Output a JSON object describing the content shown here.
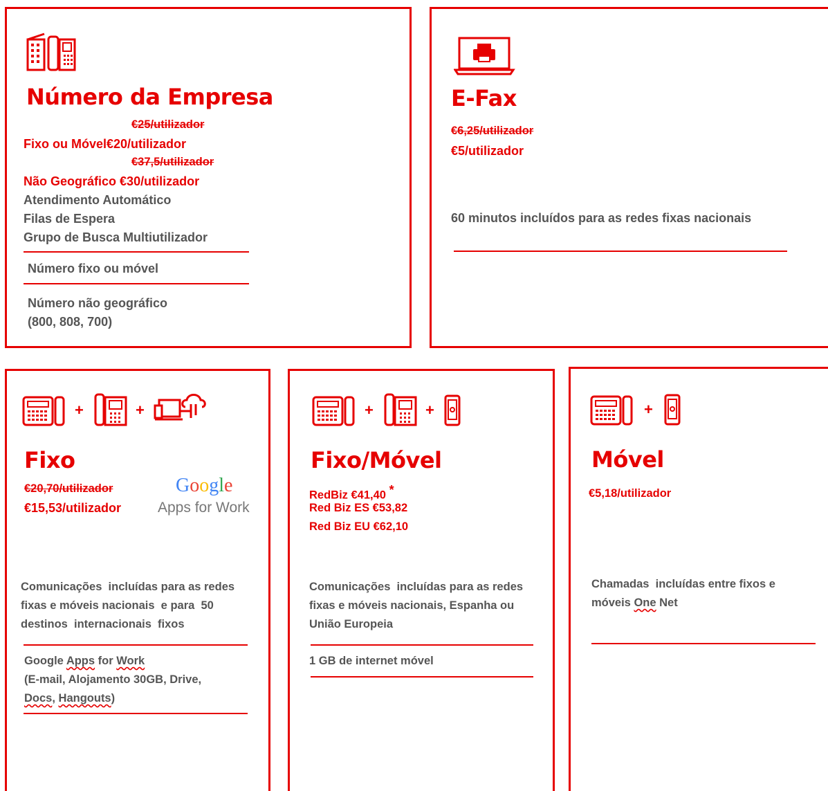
{
  "numero_empresa": {
    "icon": "office-phone-icon",
    "title": "Número da Empresa",
    "fixo_old_price": "€25/utilizador",
    "fixo_label": "Fixo ou Móvel",
    "fixo_price": "€20/utilizador",
    "ng_old_price": "€37,5/utilizador",
    "ng_label": "Não Geográfico",
    "ng_price": "€30/utilizador",
    "features": [
      "Atendimento Automático",
      "Filas de Espera",
      "Grupo de Busca Multiutilizador"
    ],
    "option_1": "Número fixo ou móvel",
    "option_2_line1": "Número não geográfico",
    "option_2_line2": "(800, 808, 700)"
  },
  "efax": {
    "icon": "laptop-fax-icon",
    "title": "E-Fax",
    "old_price": "€6,25/utilizador",
    "price": "€5/utilizador",
    "description": "60 minutos incluídos para as redes fixas nacionais"
  },
  "fixo": {
    "icons": [
      "desk-phone-icon",
      "office-phone-icon",
      "laptop-cloud-icon"
    ],
    "plus": "+",
    "title": "Fixo",
    "old_price": "€20,70/utilizador",
    "price": "€15,53/utilizador",
    "google_letters": [
      "G",
      "o",
      "o",
      "g",
      "l",
      "e"
    ],
    "google_sub": "Apps for Work",
    "description_lines": [
      "Comunicações  incluídas para as redes",
      "fixas e móveis nacionais  e para  50",
      "destinos  internacionais  fixos"
    ],
    "extra_line1_a": "Google ",
    "extra_line1_b": "Apps",
    "extra_line1_c": " for ",
    "extra_line1_d": "Work",
    "extra_line2": "(E-mail, Alojamento 30GB, Drive,",
    "extra_line3_a": "Docs",
    "extra_line3_b": ", ",
    "extra_line3_c": "Hangouts",
    "extra_line3_d": ")"
  },
  "fixo_movel": {
    "icons": [
      "desk-phone-icon",
      "office-phone-icon",
      "mobile-phone-icon"
    ],
    "plus": "+",
    "title": "Fixo/Móvel",
    "prices": [
      "RedBiz €41,40",
      "Red Biz ES €53,82",
      "Red Biz EU €62,10"
    ],
    "asterisk": "*",
    "description_lines": [
      "Comunicações  incluídas para as redes",
      "fixas e móveis nacionais, Espanha ou",
      "União Europeia"
    ],
    "extra": "1 GB de internet móvel"
  },
  "movel": {
    "icons": [
      "desk-phone-icon",
      "mobile-phone-icon"
    ],
    "plus": "+",
    "title": "Móvel",
    "price": "€5,18/utilizador",
    "description_line1": "Chamadas  incluídas entre fixos e",
    "description_line2_a": "móveis ",
    "description_line2_b": "One",
    "description_line2_c": " Net"
  },
  "colors": {
    "accent": "#e60000",
    "text_gray": "#555555"
  }
}
